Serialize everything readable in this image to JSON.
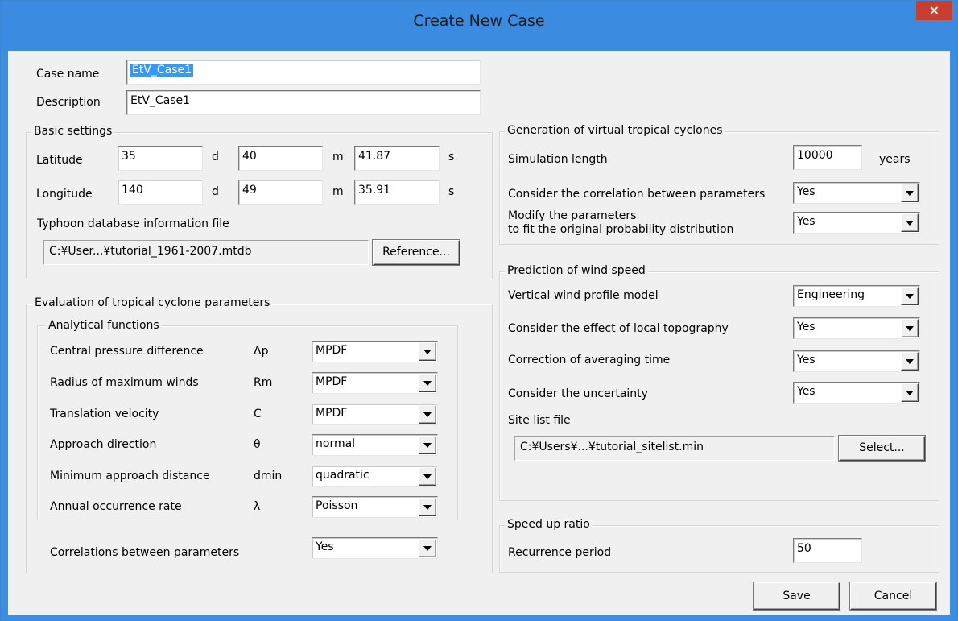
{
  "window": {
    "title": "Create New Case",
    "close_glyph": "×"
  },
  "case": {
    "name_label": "Case name",
    "name_value": "EtV_Case1",
    "desc_label": "Description",
    "desc_value": "EtV_Case1"
  },
  "basic": {
    "title": "Basic settings",
    "latitude_label": "Latitude",
    "lat_d": "35",
    "lat_m": "40",
    "lat_s": "41.87",
    "longitude_label": "Longitude",
    "lon_d": "140",
    "lon_m": "49",
    "lon_s": "35.91",
    "unit_d": "d",
    "unit_m": "m",
    "unit_s": "s",
    "db_label": "Typhoon database information file",
    "db_path": "C:¥User...¥tutorial_1961-2007.mtdb",
    "reference_button": "Reference..."
  },
  "evaluation": {
    "title": "Evaluation of tropical cyclone parameters",
    "analytical_title": "Analytical functions",
    "rows": [
      {
        "label": "Central pressure difference",
        "symbol": "Δp",
        "value": "MPDF"
      },
      {
        "label": "Radius of maximum winds",
        "symbol": "Rm",
        "value": "MPDF"
      },
      {
        "label": "Translation velocity",
        "symbol": "C",
        "value": "MPDF"
      },
      {
        "label": "Approach direction",
        "symbol": "θ",
        "value": "normal"
      },
      {
        "label": "Minimum approach distance",
        "symbol": "dmin",
        "value": "quadratic"
      },
      {
        "label": "Annual occurrence rate",
        "symbol": "λ",
        "value": "Poisson"
      }
    ],
    "correlations_label": "Correlations between parameters",
    "correlations_value": "Yes"
  },
  "generation": {
    "title": "Generation of virtual tropical cyclones",
    "sim_label": "Simulation length",
    "sim_value": "10000",
    "sim_unit": "years",
    "corr_label": "Consider the correlation between parameters",
    "corr_value": "Yes",
    "modify_label_1": "Modify the parameters",
    "modify_label_2": "to fit the original probability distribution",
    "modify_value": "Yes"
  },
  "prediction": {
    "title": "Prediction of wind speed",
    "profile_label": "Vertical wind profile model",
    "profile_value": "Engineering",
    "topo_label": "Consider the effect of local topography",
    "topo_value": "Yes",
    "avg_label": "Correction of averaging time",
    "avg_value": "Yes",
    "unc_label": "Consider the uncertainty",
    "unc_value": "Yes",
    "site_label": "Site list file",
    "site_path": "C:¥Users¥...¥tutorial_sitelist.min",
    "select_button": "Select..."
  },
  "speedup": {
    "title": "Speed up ratio",
    "period_label": "Recurrence period",
    "period_value": "50"
  },
  "buttons": {
    "save": "Save",
    "cancel": "Cancel"
  },
  "icons": {
    "close": "close-icon",
    "dropdown": "chevron-down-icon"
  },
  "colors": {
    "titlebar": "#3b8be0",
    "close": "#c7402f",
    "selection": "#3399ff",
    "client": "#f0f0f0"
  }
}
